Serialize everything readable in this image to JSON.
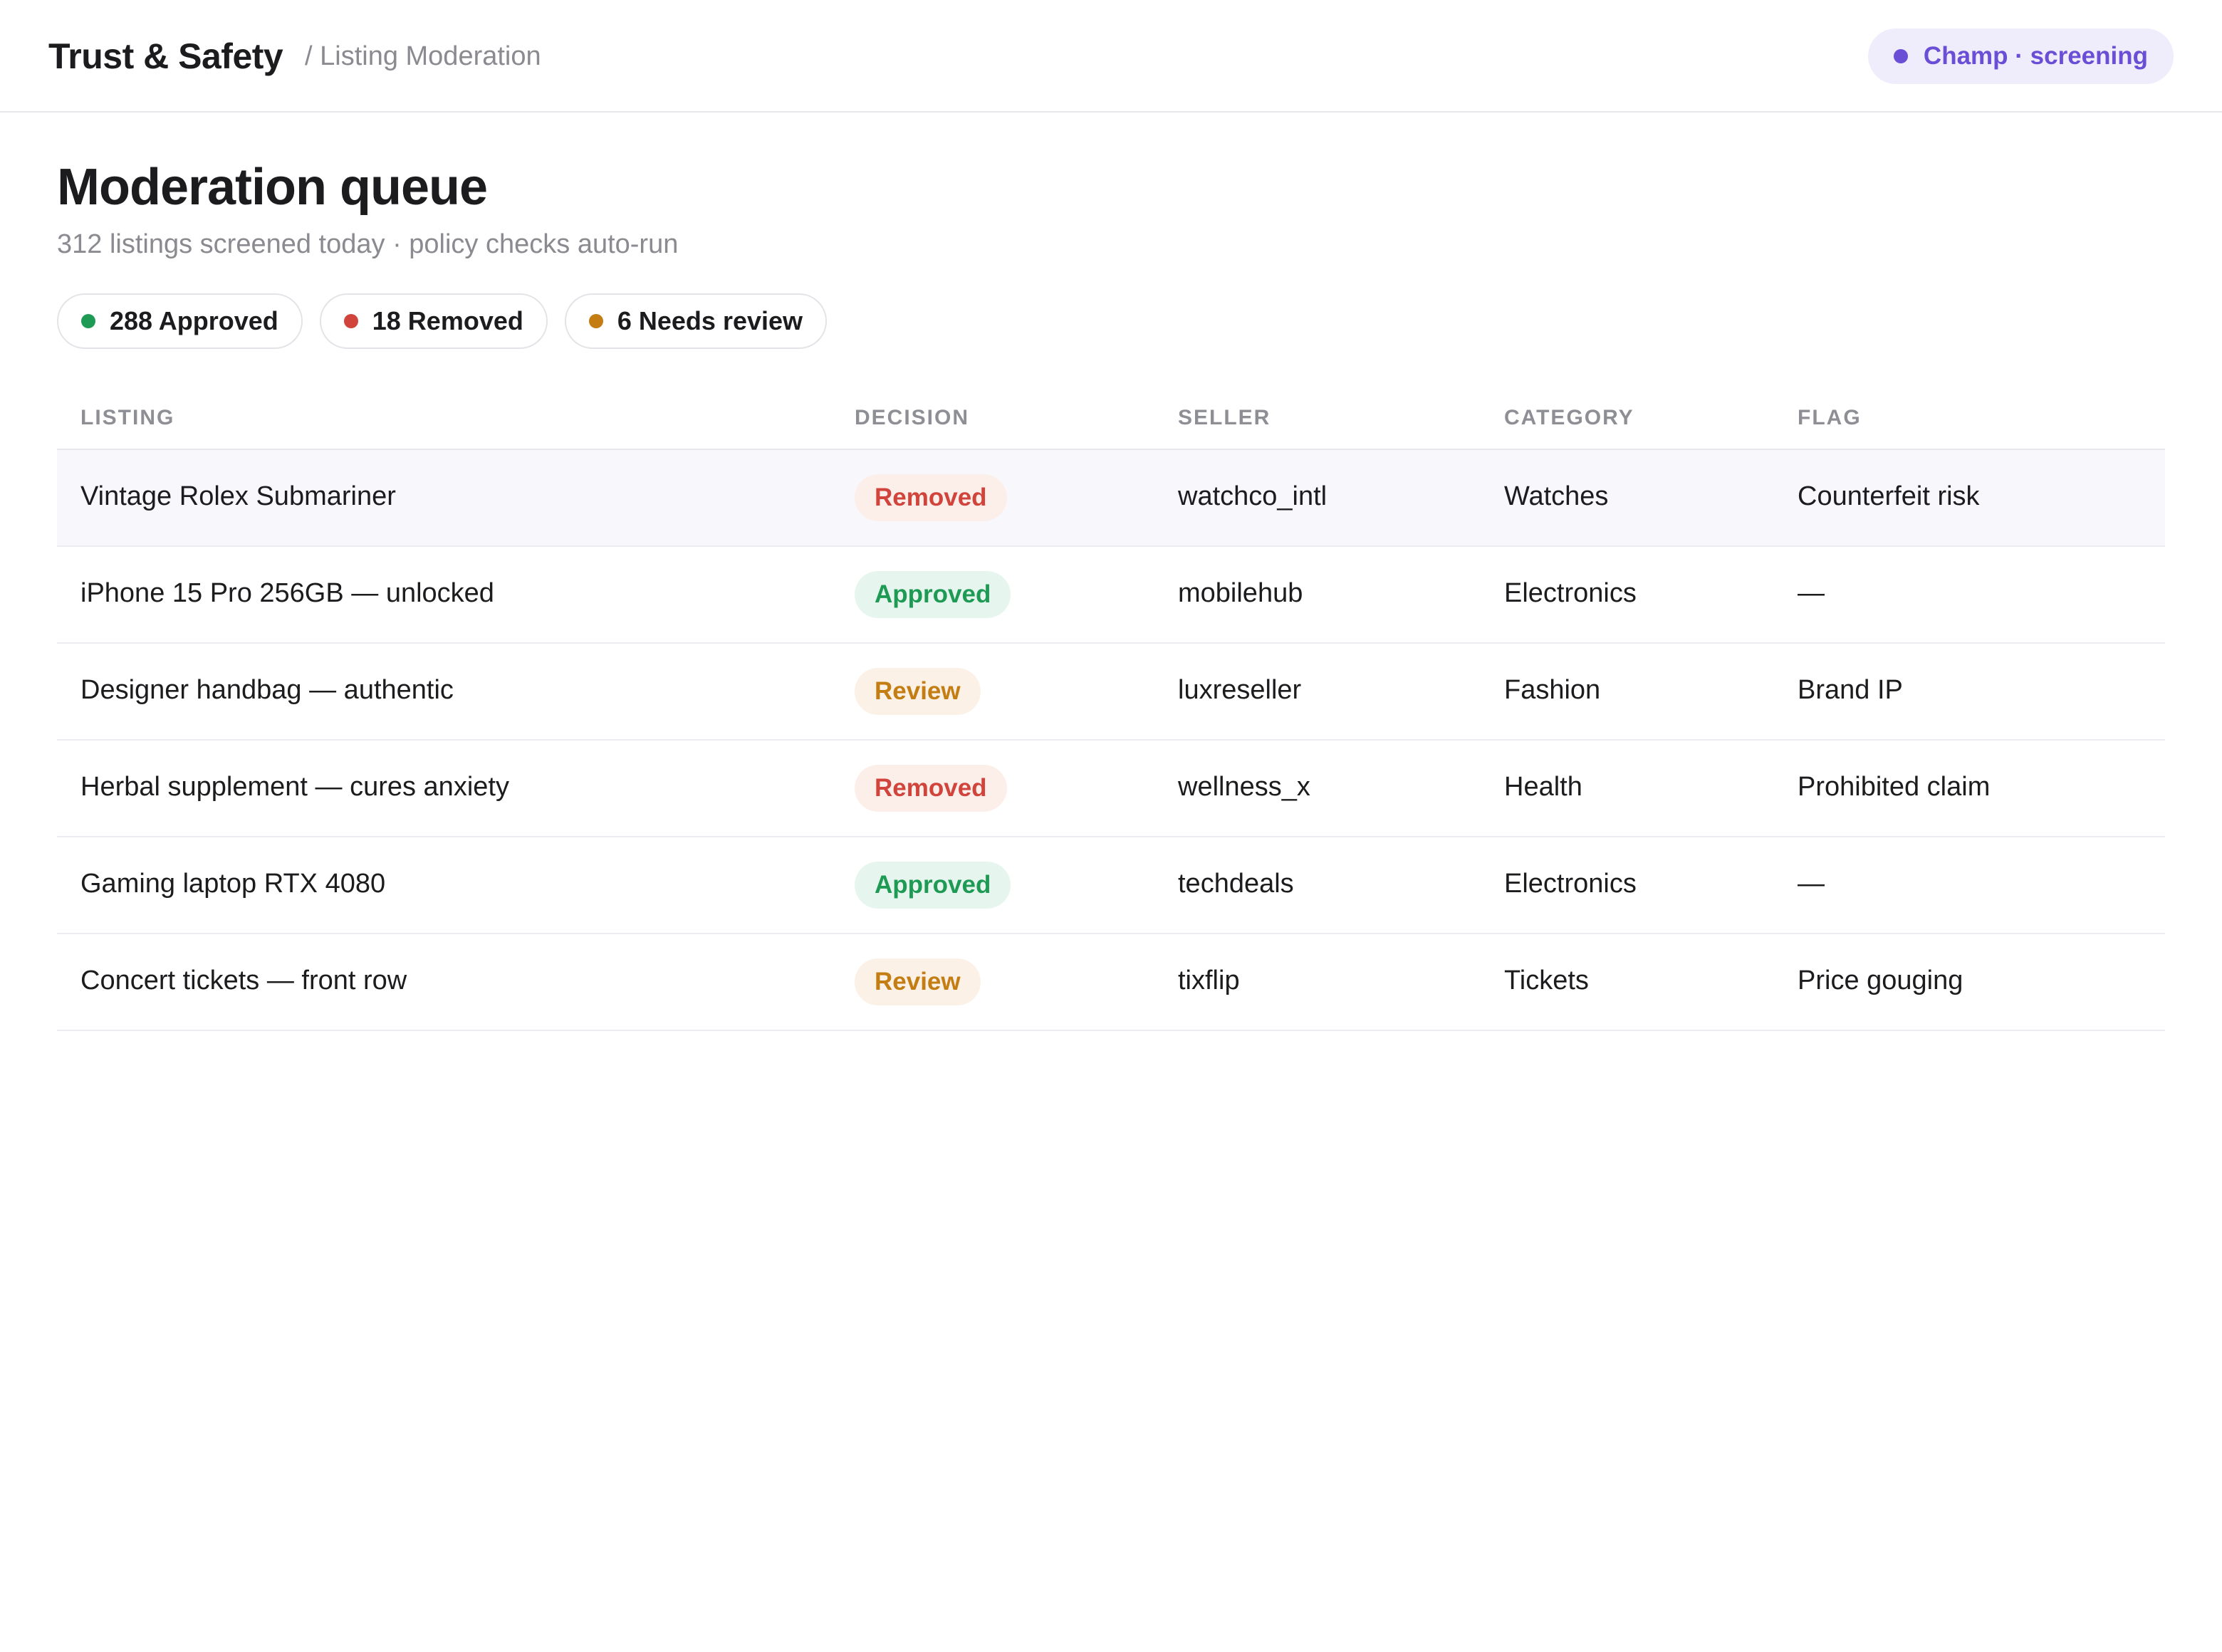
{
  "header": {
    "brand": "Trust & Safety",
    "breadcrumb": "/ Listing Moderation",
    "session_label": "Champ · screening",
    "session_color": "#6a4fd6"
  },
  "page": {
    "title": "Moderation queue",
    "subtitle": "312 listings screened today · policy checks auto-run"
  },
  "summary_chips": [
    {
      "label": "288 Approved",
      "dot_color": "#1f9a55"
    },
    {
      "label": "18 Removed",
      "dot_color": "#d0443c"
    },
    {
      "label": "6 Needs review",
      "dot_color": "#c47d12"
    }
  ],
  "table": {
    "columns": [
      "LISTING",
      "DECISION",
      "SELLER",
      "CATEGORY",
      "FLAG"
    ],
    "rows": [
      {
        "listing": "Vintage Rolex Submariner",
        "decision": "Removed",
        "status": "removed",
        "seller": "watchco_intl",
        "category": "Watches",
        "flag": "Counterfeit risk"
      },
      {
        "listing": "iPhone 15 Pro 256GB — unlocked",
        "decision": "Approved",
        "status": "approved",
        "seller": "mobilehub",
        "category": "Electronics",
        "flag": "—"
      },
      {
        "listing": "Designer handbag — authentic",
        "decision": "Review",
        "status": "review",
        "seller": "luxreseller",
        "category": "Fashion",
        "flag": "Brand IP"
      },
      {
        "listing": "Herbal supplement — cures anxiety",
        "decision": "Removed",
        "status": "removed",
        "seller": "wellness_x",
        "category": "Health",
        "flag": "Prohibited claim"
      },
      {
        "listing": "Gaming laptop RTX 4080",
        "decision": "Approved",
        "status": "approved",
        "seller": "techdeals",
        "category": "Electronics",
        "flag": "—"
      },
      {
        "listing": "Concert tickets — front row",
        "decision": "Review",
        "status": "review",
        "seller": "tixflip",
        "category": "Tickets",
        "flag": "Price gouging"
      }
    ]
  }
}
